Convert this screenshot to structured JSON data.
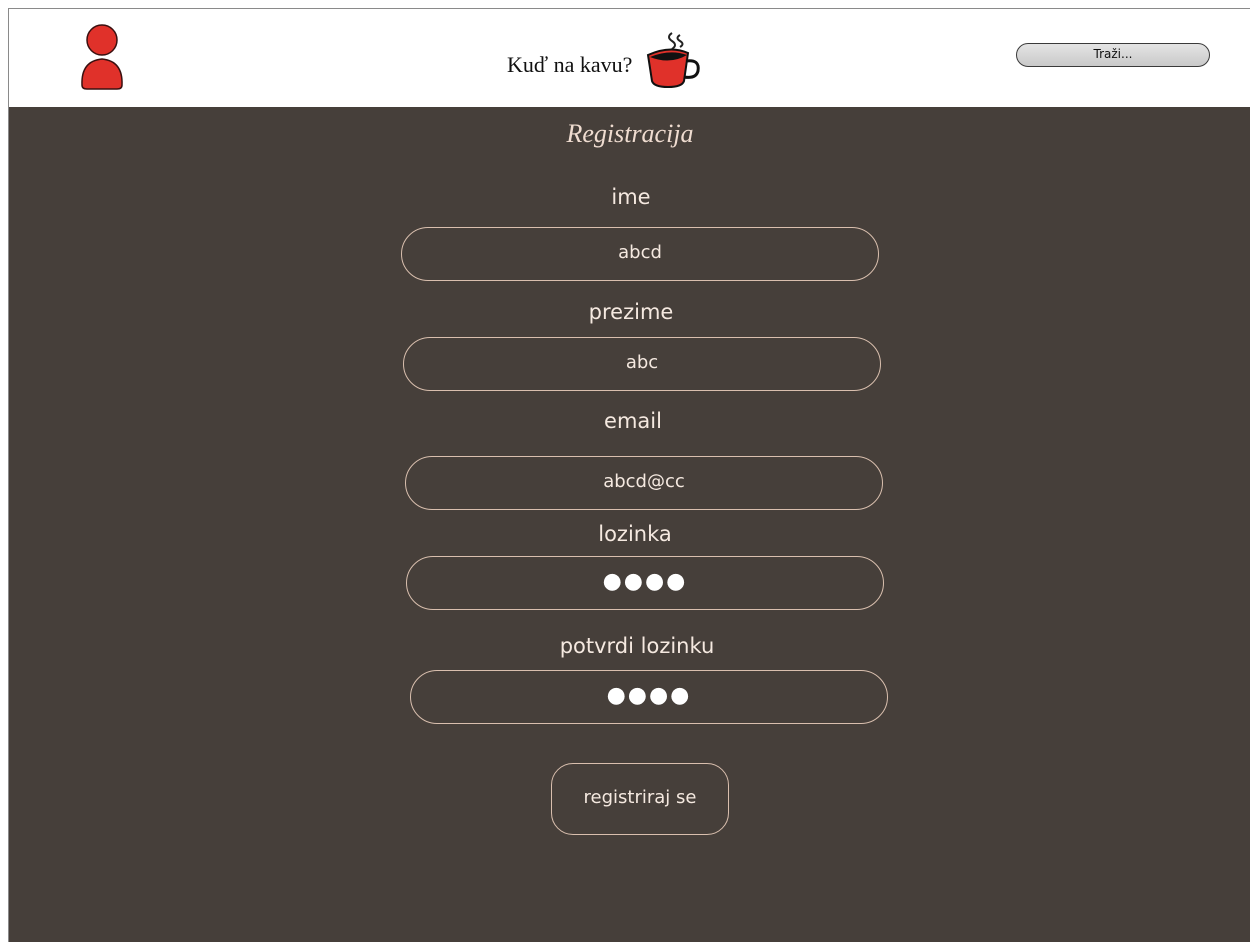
{
  "header": {
    "avatar_icon": "user-avatar-icon",
    "brand_text": "Kuď na kavu?",
    "logo_icon": "coffee-cup-icon",
    "search_label": "Traži..."
  },
  "form": {
    "title": "Registracija",
    "fields": [
      {
        "label": "ime",
        "value": "abcd",
        "type": "text"
      },
      {
        "label": "prezime",
        "value": "abc",
        "type": "text"
      },
      {
        "label": "email",
        "value": "abcd@cc",
        "type": "text"
      },
      {
        "label": "lozinka",
        "value": "●●●●",
        "type": "password"
      },
      {
        "label": "potvrdi lozinku",
        "value": "●●●●",
        "type": "password"
      }
    ],
    "submit_label": "registriraj se"
  },
  "colors": {
    "background": "#463f3a",
    "accent_red": "#e0312a",
    "field_border": "#d9bfae",
    "text_light": "#f5e9e0"
  }
}
